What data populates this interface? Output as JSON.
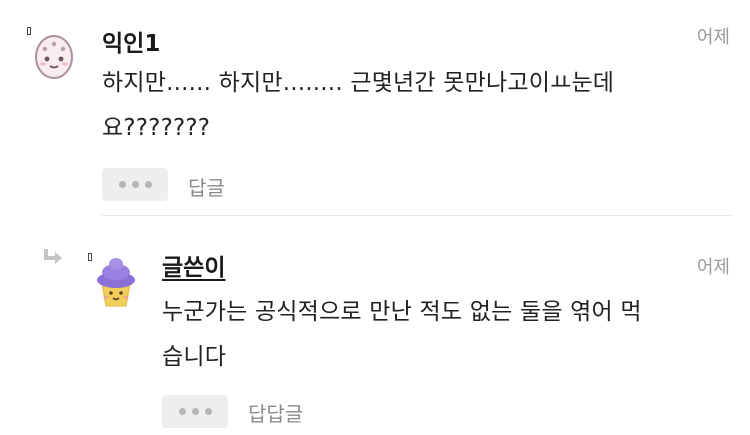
{
  "comments": [
    {
      "author": "익인1",
      "time": "어제",
      "text_line1": "하지만...... 하지만........ 근몇년간 못만나고이ㅛ눈데",
      "text_line2": "요???????",
      "reply_label": "답글",
      "avatar_icon": "egg-avatar-icon"
    },
    {
      "author": "글쓴이",
      "time": "어제",
      "text_line1": "누군가는 공식적으로 만난 적도 없는 둘을 엮어 먹",
      "text_line2": "습니다",
      "reply_label": "답답글",
      "avatar_icon": "cupcake-avatar-icon"
    }
  ],
  "colors": {
    "text": "#222222",
    "muted": "#8a8a8a",
    "button_bg": "#eeeeee",
    "cupcake_frosting": "#8a6fd6",
    "cupcake_base": "#f2cf5b"
  }
}
